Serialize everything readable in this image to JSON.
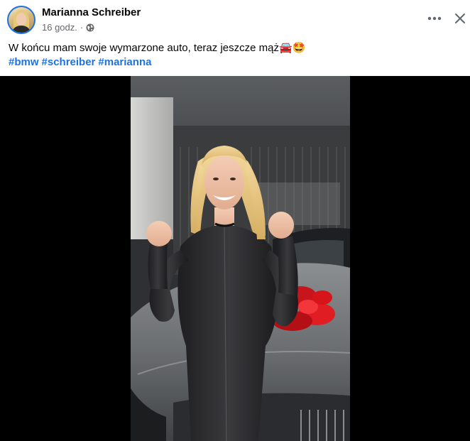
{
  "post": {
    "author": "Marianna Schreiber",
    "time": "16 godz.",
    "separator": "·",
    "caption": "W końcu mam swoje wymarzone auto, teraz jeszcze mąż🚘🤩",
    "hashtags": [
      "#bmw",
      "#schreiber",
      "#marianna"
    ],
    "more_icon": "more-horizontal-icon",
    "close_icon": "close-icon",
    "privacy_icon": "globe-icon"
  },
  "colors": {
    "link": "#1b74e4",
    "secondary_text": "#65676b",
    "video_background": "#000000",
    "bow_red": "#d8141b"
  }
}
